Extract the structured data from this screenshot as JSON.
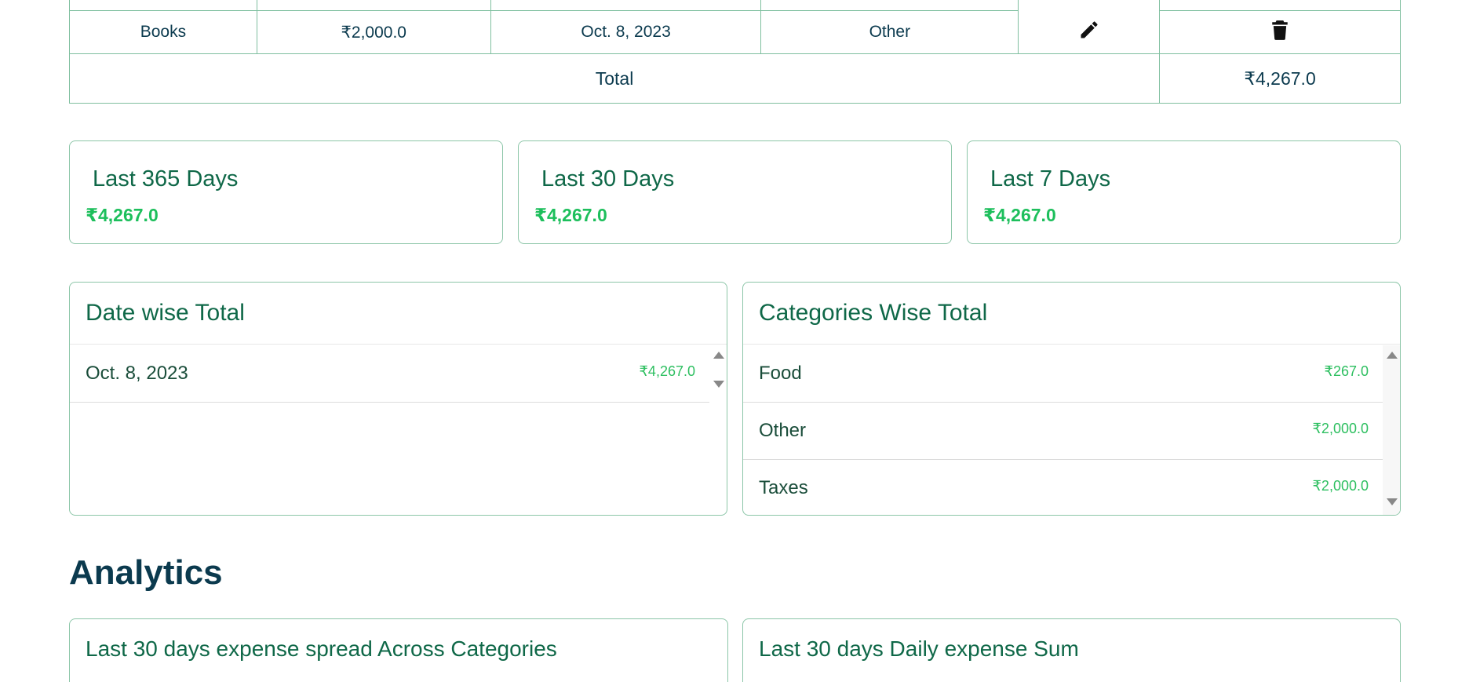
{
  "table": {
    "row": {
      "title": "Books",
      "amount": "₹2,000.0",
      "date": "Oct. 8, 2023",
      "category": "Other",
      "edit_icon": "pencil-icon",
      "delete_icon": "trash-icon"
    },
    "total_label": "Total",
    "total_value": "₹4,267.0"
  },
  "summary": [
    {
      "title": "Last 365 Days",
      "value": "₹4,267.0"
    },
    {
      "title": "Last 30 Days",
      "value": "₹4,267.0"
    },
    {
      "title": "Last 7 Days",
      "value": "₹4,267.0"
    }
  ],
  "date_wise": {
    "title": "Date wise Total",
    "items": [
      {
        "label": "Oct. 8, 2023",
        "amount": "₹4,267.0"
      }
    ]
  },
  "category_wise": {
    "title": "Categories Wise Total",
    "items": [
      {
        "label": "Food",
        "amount": "₹267.0"
      },
      {
        "label": "Other",
        "amount": "₹2,000.0"
      },
      {
        "label": "Taxes",
        "amount": "₹2,000.0"
      }
    ]
  },
  "analytics": {
    "heading": "Analytics",
    "charts": [
      {
        "title": "Last 30 days expense spread Across Categories"
      },
      {
        "title": "Last 30 days Daily expense Sum"
      }
    ]
  },
  "colors": {
    "heading": "#0b3a4e",
    "card_title": "#0f6848",
    "amount_green": "#1dbf5c",
    "border": "#8cc6a8"
  }
}
